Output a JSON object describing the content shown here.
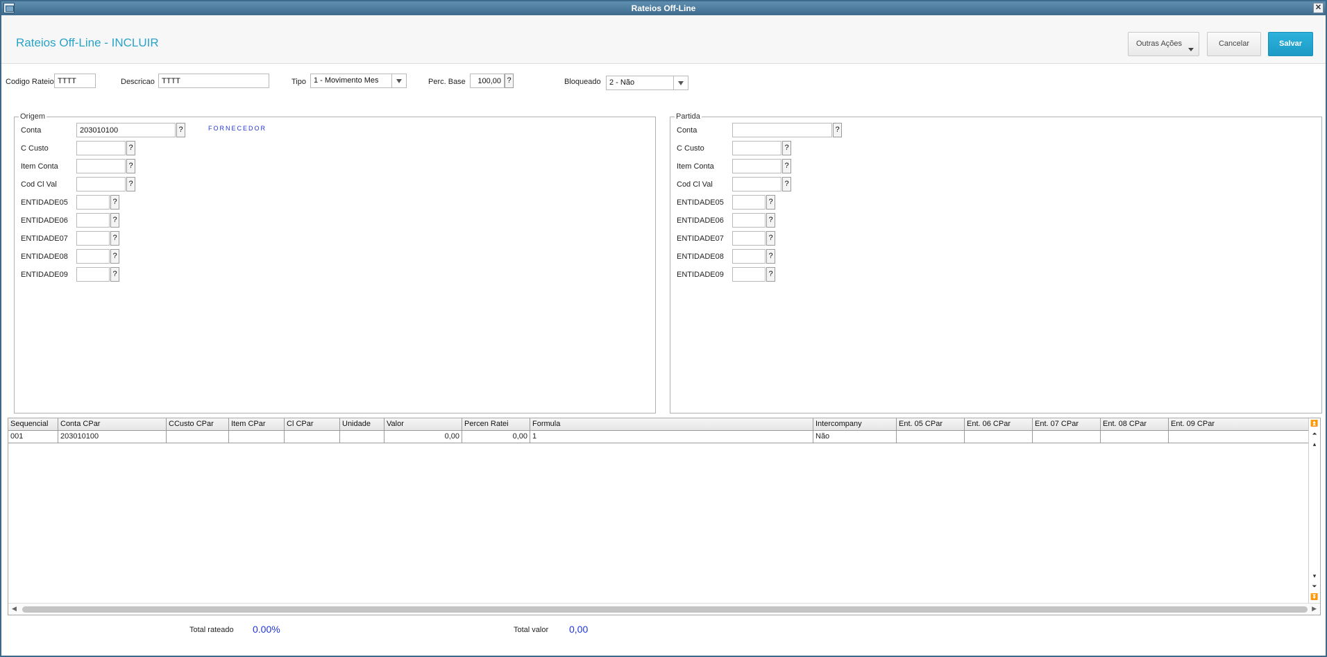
{
  "window": {
    "title": "Rateios Off-Line"
  },
  "header": {
    "title": "Rateios Off-Line - INCLUIR",
    "other_actions_label": "Outras Ações",
    "cancel_label": "Cancelar",
    "save_label": "Salvar"
  },
  "form": {
    "codigo_rateio": {
      "label": "Codigo Rateio",
      "value": "TTTT"
    },
    "descricao": {
      "label": "Descricao",
      "value": "TTTT"
    },
    "tipo": {
      "label": "Tipo",
      "value": "1 - Movimento Mes"
    },
    "perc_base": {
      "label": "Perc. Base",
      "value": "100,00"
    },
    "bloqueado": {
      "label": "Bloqueado",
      "value": "2 - Não"
    }
  },
  "origem": {
    "legend": "Origem",
    "conta_hint": "FORNECEDOR",
    "fields": [
      {
        "label": "Conta",
        "value": "203010100"
      },
      {
        "label": "C Custo",
        "value": ""
      },
      {
        "label": "Item Conta",
        "value": ""
      },
      {
        "label": "Cod Cl Val",
        "value": ""
      },
      {
        "label": "ENTIDADE05",
        "value": ""
      },
      {
        "label": "ENTIDADE06",
        "value": ""
      },
      {
        "label": "ENTIDADE07",
        "value": ""
      },
      {
        "label": "ENTIDADE08",
        "value": ""
      },
      {
        "label": "ENTIDADE09",
        "value": ""
      }
    ]
  },
  "partida": {
    "legend": "Partida",
    "fields": [
      {
        "label": "Conta",
        "value": ""
      },
      {
        "label": "C Custo",
        "value": ""
      },
      {
        "label": "Item Conta",
        "value": ""
      },
      {
        "label": "Cod Cl Val",
        "value": ""
      },
      {
        "label": "ENTIDADE05",
        "value": ""
      },
      {
        "label": "ENTIDADE06",
        "value": ""
      },
      {
        "label": "ENTIDADE07",
        "value": ""
      },
      {
        "label": "ENTIDADE08",
        "value": ""
      },
      {
        "label": "ENTIDADE09",
        "value": ""
      }
    ]
  },
  "lookup_label": "?",
  "grid": {
    "columns": [
      "Sequencial",
      "Conta CPar",
      "CCusto CPar",
      "Item CPar",
      "Cl CPar",
      "Unidade",
      "Valor",
      "Percen Ratei",
      "Formula",
      "Intercompany",
      "Ent. 05 CPar",
      "Ent. 06 CPar",
      "Ent. 07 CPar",
      "Ent. 08 CPar",
      "Ent. 09 CPar"
    ],
    "rows": [
      [
        "001",
        "203010100",
        "",
        "",
        "",
        "",
        "0,00",
        "0,00",
        "1",
        "Não",
        "",
        "",
        "",
        "",
        ""
      ]
    ]
  },
  "totals": {
    "rateado_label": "Total rateado",
    "rateado_value": "0.00%",
    "valor_label": "Total valor",
    "valor_value": "0,00"
  }
}
